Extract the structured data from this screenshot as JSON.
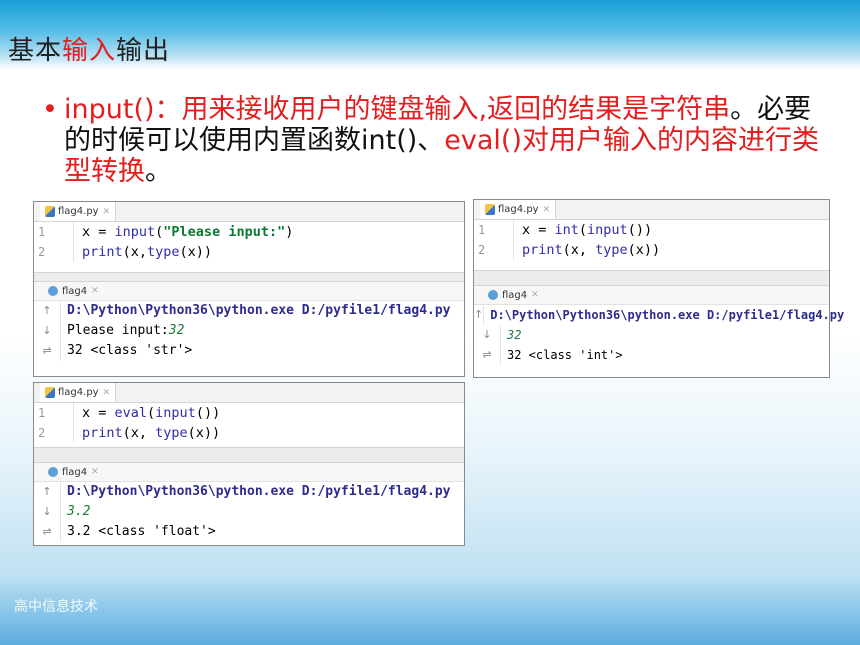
{
  "slide": {
    "title_plain1": "基本",
    "title_red": "输入",
    "title_plain2": "输出",
    "bullet_dot": "•",
    "bullet_part1": "input()：",
    "bullet_part2": "用来接收用户的键盘输入,返回的结果是字符串",
    "bullet_part3": "。必要的时候可以使用内置函数int()、",
    "bullet_part4": "eval()对用户输入的内容进行类型转换",
    "bullet_part5": "。",
    "footer": "高中信息技术"
  },
  "panels": [
    {
      "tab": "flag4.py",
      "code": [
        {
          "ln": "1",
          "a": "x = ",
          "b": "input",
          "c": "(",
          "d": "\"Please input:\"",
          "e": ")"
        },
        {
          "ln": "2",
          "a": "",
          "b": "print",
          "c": "(x,",
          "d": "type",
          "e": "(x))"
        }
      ],
      "run_tab": "flag4",
      "console": [
        {
          "gut": "↑",
          "text": "D:\\Python\\Python36\\python.exe D:/pyfile1/flag4.py"
        },
        {
          "gut": "↓",
          "text1": "Please input:",
          "text2": "32"
        },
        {
          "gut": "⇌",
          "text": "32 <class 'str'>"
        }
      ]
    },
    {
      "tab": "flag4.py",
      "code": [
        {
          "ln": "1",
          "a": "x = ",
          "b": "int",
          "c": "(",
          "d": "input",
          "e": "())"
        },
        {
          "ln": "2",
          "a": "",
          "b": "print",
          "c": "(x, ",
          "d": "type",
          "e": "(x))"
        }
      ],
      "run_tab": "flag4",
      "console": [
        {
          "gut": "↑",
          "text": "D:\\Python\\Python36\\python.exe D:/pyfile1/flag4.py"
        },
        {
          "gut": "↓",
          "text2": "32"
        },
        {
          "gut": "⇌",
          "text": "32 <class 'int'>"
        }
      ]
    },
    {
      "tab": "flag4.py",
      "code": [
        {
          "ln": "1",
          "a": "x = ",
          "b": "eval",
          "c": "(",
          "d": "input",
          "e": "())"
        },
        {
          "ln": "2",
          "a": "",
          "b": "print",
          "c": "(x, ",
          "d": "type",
          "e": "(x))"
        }
      ],
      "run_tab": "flag4",
      "console": [
        {
          "gut": "↑",
          "text": "D:\\Python\\Python36\\python.exe D:/pyfile1/flag4.py"
        },
        {
          "gut": "↓",
          "text2": "3.2"
        },
        {
          "gut": "⇌",
          "text": "3.2 <class 'float'>"
        }
      ]
    }
  ]
}
